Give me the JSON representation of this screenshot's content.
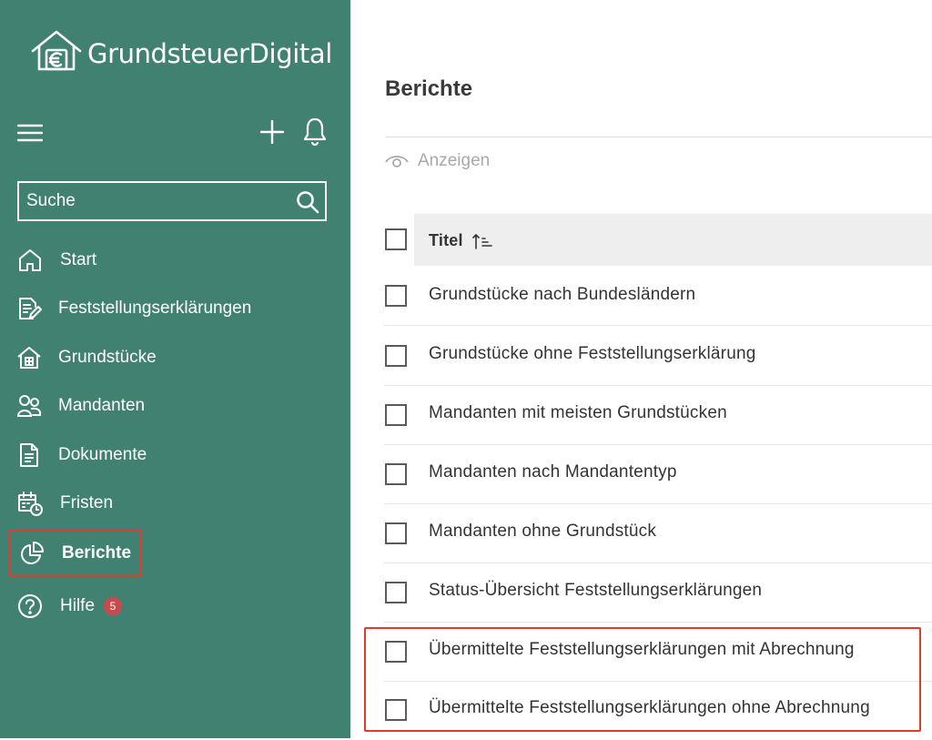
{
  "brand": {
    "name": "GrundsteuerDigital"
  },
  "sidebar": {
    "search_placeholder": "Suche",
    "items": [
      {
        "label": "Start",
        "icon": "home-icon"
      },
      {
        "label": "Feststellungserklärungen",
        "icon": "document-edit-icon"
      },
      {
        "label": "Grundstücke",
        "icon": "building-icon"
      },
      {
        "label": "Mandanten",
        "icon": "users-icon"
      },
      {
        "label": "Dokumente",
        "icon": "file-icon"
      },
      {
        "label": "Fristen",
        "icon": "calendar-clock-icon"
      },
      {
        "label": "Berichte",
        "icon": "pie-chart-icon",
        "active": true
      },
      {
        "label": "Hilfe",
        "icon": "help-icon",
        "badge": "5"
      }
    ]
  },
  "main": {
    "title": "Berichte",
    "show_label": "Anzeigen",
    "table": {
      "header": "Titel",
      "rows": [
        "Grundstücke nach Bundesländern",
        "Grundstücke ohne Feststellungserklärung",
        "Mandanten mit meisten Grundstücken",
        "Mandanten nach Mandantentyp",
        "Mandanten ohne Grundstück",
        "Status-Übersicht Feststellungserklärungen",
        "Übermittelte Feststellungserklärungen mit Abrechnung",
        "Übermittelte Feststellungserklärungen ohne Abrechnung"
      ]
    }
  },
  "colors": {
    "sidebar_bg": "#418172",
    "highlight": "#e03b2b",
    "badge": "#c94a4e"
  }
}
